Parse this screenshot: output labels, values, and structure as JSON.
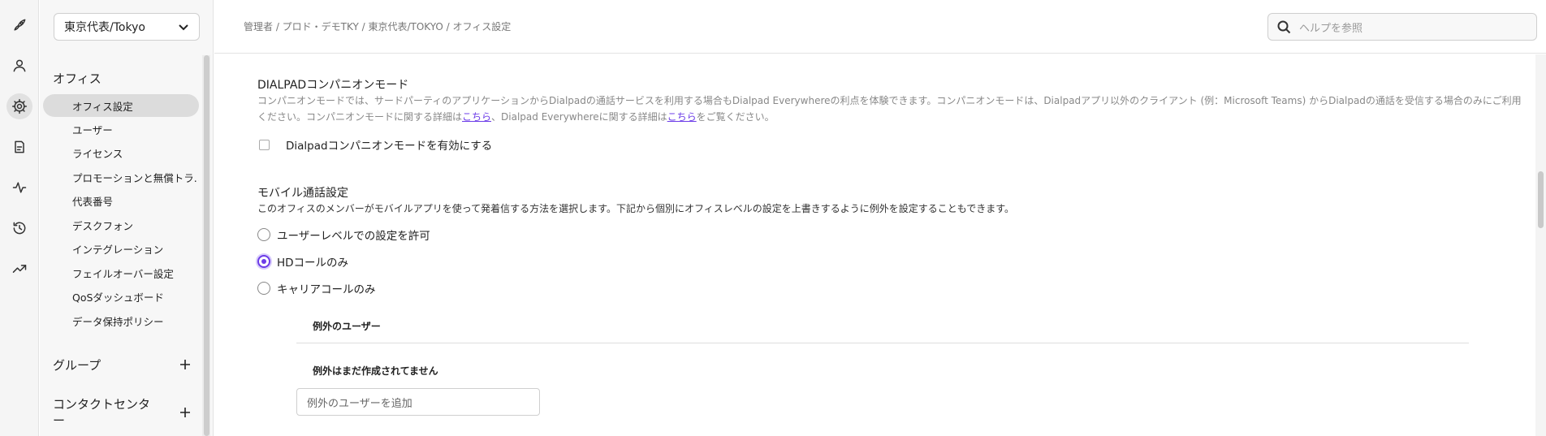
{
  "rail": {
    "icons": [
      "rocket-icon",
      "user-icon",
      "gear-icon",
      "report-icon",
      "activity-icon",
      "history-icon",
      "trending-icon"
    ]
  },
  "sidebar": {
    "office_select": "東京代表/Tokyo",
    "section_office": "オフィス",
    "items": [
      {
        "label": "オフィス設定",
        "active": true
      },
      {
        "label": "ユーザー"
      },
      {
        "label": "ライセンス"
      },
      {
        "label": "プロモーションと無償トラ..."
      },
      {
        "label": "代表番号"
      },
      {
        "label": "デスクフォン"
      },
      {
        "label": "インテグレーション"
      },
      {
        "label": "フェイルオーバー設定"
      },
      {
        "label": "QoSダッシュボード"
      },
      {
        "label": "データ保持ポリシー"
      }
    ],
    "section_groups": "グループ",
    "section_contact_center": "コンタクトセンター"
  },
  "header": {
    "breadcrumb": "管理者 / プロド・デモTKY / 東京代表/TOKYO / オフィス設定",
    "search_placeholder": "ヘルプを参照"
  },
  "companion": {
    "title": "DIALPADコンパニオンモード",
    "desc_line1": "コンパニオンモードでは、サードパーティのアプリケーションからDialpadの通話サービスを利用する場合もDialpad Everywhereの利点を体験できます。コンパニオンモードは、Dialpadアプリ以外のクライアント (例：Microsoft Teams) からDialpadの通話を受信する場合のみにご利用",
    "desc_line2_a": "ください。コンパニオンモードに関する詳細は",
    "link1": "こちら",
    "desc_line2_b": "、Dialpad Everywhereに関する詳細は",
    "link2": "こちら",
    "desc_line2_c": "をご覧ください。",
    "checkbox_label": "Dialpadコンパニオンモードを有効にする",
    "checkbox_checked": false
  },
  "mobile": {
    "title": "モバイル通話設定",
    "desc": "このオフィスのメンバーがモバイルアプリを使って発着信する方法を選択します。下記から個別にオフィスレベルの設定を上書きするように例外を設定することもできます。",
    "options": [
      {
        "label": "ユーザーレベルでの設定を許可",
        "checked": false
      },
      {
        "label": "HDコールのみ",
        "checked": true
      },
      {
        "label": "キャリアコールのみ",
        "checked": false
      }
    ],
    "exceptions_header": "例外のユーザー",
    "exceptions_empty": "例外はまだ作成されてません",
    "add_exception_placeholder": "例外のユーザーを追加"
  },
  "colors": {
    "accent": "#6c3ce8",
    "active_nav": "#dcdcdc"
  }
}
